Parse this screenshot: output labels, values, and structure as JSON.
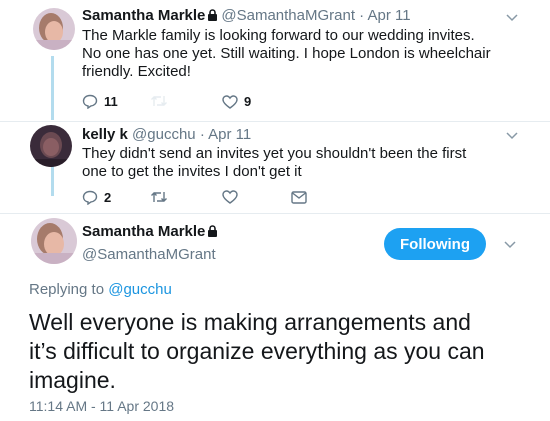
{
  "tweet1": {
    "name": "Samantha Markle",
    "handle": "@SamanthaMGrant",
    "date": "Apr 11",
    "text_lines": [
      "The Markle family is looking forward to our wedding invites.",
      "No one has one yet. Still waiting.  I hope London is wheelchair",
      "friendly.  Excited!"
    ],
    "reply_count": "11",
    "retweet_count": "",
    "like_count": "9"
  },
  "tweet2": {
    "name": "kelly k",
    "handle": "@gucchu",
    "date": "Apr 11",
    "text_lines": [
      "They didn't send an invites yet you shouldn't  been the  first",
      "one  to get the invites   I don't get it"
    ],
    "reply_count": "2",
    "retweet_count": "",
    "like_count": ""
  },
  "main": {
    "name": "Samantha Markle",
    "handle": "@SamanthaMGrant",
    "follow_label": "Following",
    "replying_prefix": "Replying to",
    "replying_handle": "@gucchu",
    "text_lines": [
      "Well everyone is making arrangements and",
      "it’s difficult to organize everything as you can",
      "imagine."
    ],
    "timestamp": "11:14 AM - 11 Apr 2018"
  },
  "colors": {
    "accent": "#1da1f2",
    "thread": "#b3dcee",
    "muted": "#657786"
  },
  "icons": [
    "lock-icon",
    "chevron-down-icon",
    "reply-icon",
    "retweet-icon",
    "like-icon",
    "message-icon"
  ]
}
